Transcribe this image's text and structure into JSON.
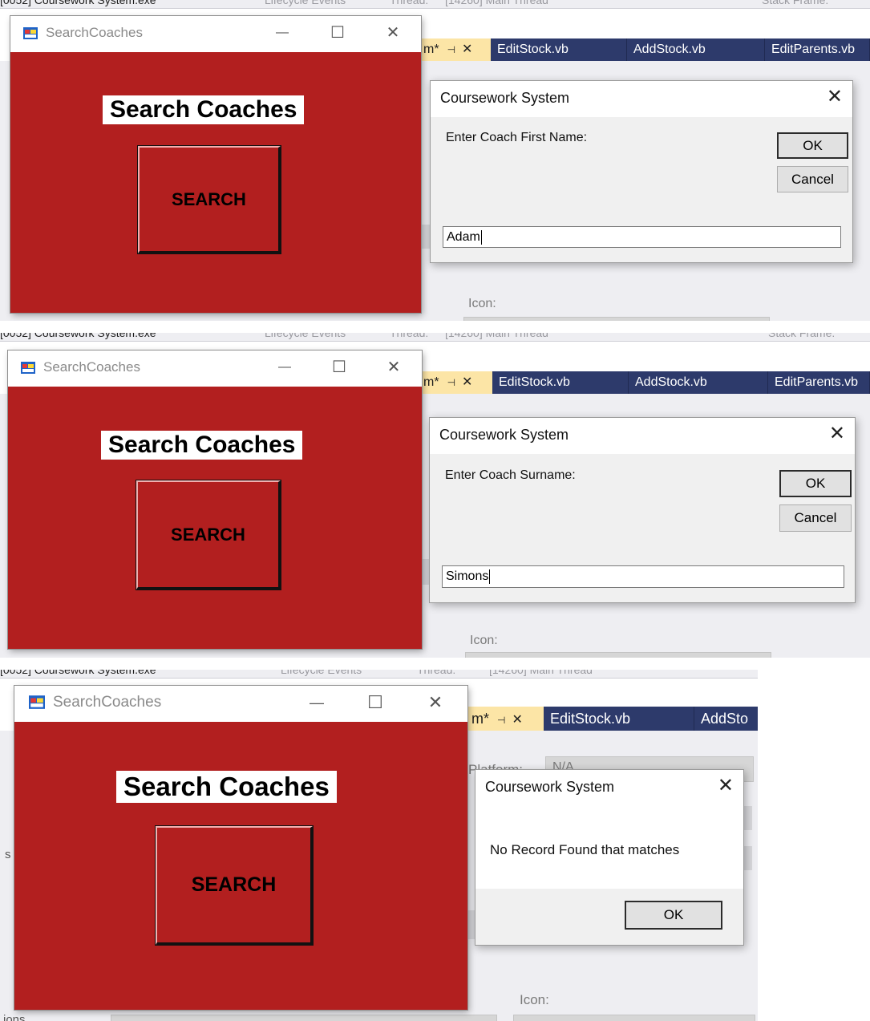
{
  "ide": {
    "process": "[0052] Coursework System.exe",
    "lifecycle": "Lifecycle Events",
    "thread_label": "Thread:",
    "thread_value": "[14260] Main Thread",
    "stack_frame": "Stack Frame:",
    "tabs": [
      "m*",
      "EditStock.vb",
      "AddStock.vb",
      "EditParents.vb"
    ],
    "tabs_short": [
      "m*",
      "EditStock.vb",
      "AddSto"
    ],
    "pin_glyph": "⊣",
    "close_glyph": "✕",
    "platform_label": "Platform:",
    "platform_value": "N/A",
    "icon_label": "Icon:",
    "side_labels": [
      "s",
      "ions"
    ]
  },
  "form": {
    "title": "SearchCoaches",
    "heading": "Search Coaches",
    "search_button": "SEARCH",
    "minimize": "—",
    "maximize": "☐",
    "close": "✕"
  },
  "dialogs": {
    "title": "Coursework System",
    "close": "✕",
    "first": {
      "prompt": "Enter Coach First Name:",
      "ok": "OK",
      "cancel": "Cancel",
      "input_value": "Adam"
    },
    "second": {
      "prompt": "Enter Coach Surname:",
      "ok": "OK",
      "cancel": "Cancel",
      "input_value": "Simons"
    },
    "third": {
      "message": "No Record Found that matches",
      "ok": "OK"
    }
  },
  "colors": {
    "form_background": "#b21f1f",
    "ide_tab_bar": "#2d3a6b",
    "ide_active_tab": "#fce5a6",
    "dialog_background": "#f0f0f0"
  }
}
